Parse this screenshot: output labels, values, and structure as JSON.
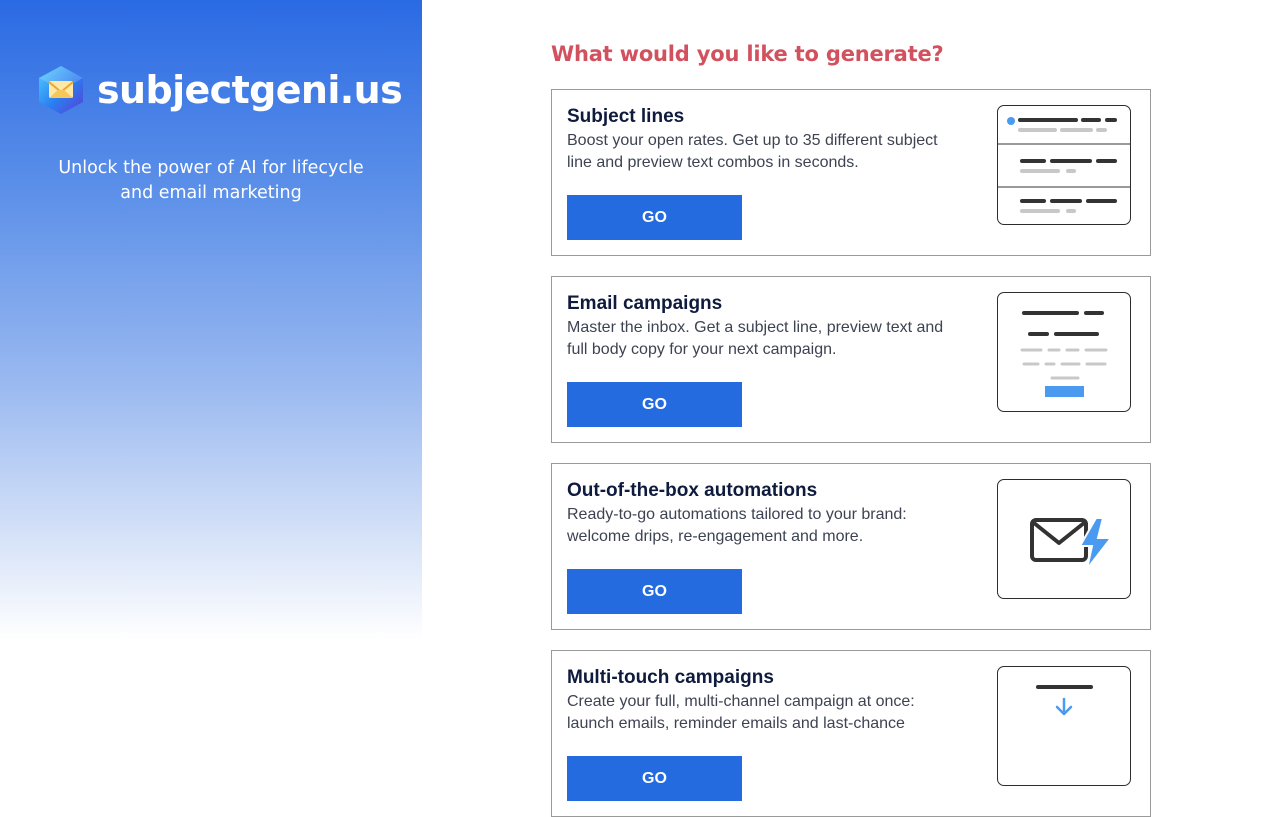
{
  "brand": {
    "name": "subjectgeni.us",
    "tagline": "Unlock the power of AI for lifecycle and email marketing",
    "logo_icon": "envelope-cube-icon"
  },
  "main": {
    "heading": "What would you like to generate?",
    "cards": [
      {
        "title": "Subject lines",
        "description": "Boost your open rates. Get up to 35 different subject line and preview text combos in seconds.",
        "button_label": "GO",
        "illustration": "subject-lines-list-icon"
      },
      {
        "title": "Email campaigns",
        "description": "Master the inbox. Get a subject line, preview text and full body copy for your next campaign.",
        "button_label": "GO",
        "illustration": "email-document-icon"
      },
      {
        "title": "Out-of-the-box automations",
        "description": "Ready-to-go automations tailored to your brand: welcome drips, re-engagement and more.",
        "button_label": "GO",
        "illustration": "envelope-lightning-icon"
      },
      {
        "title": "Multi-touch campaigns",
        "description": "Create your full, multi-channel campaign at once: launch emails, reminder emails and last-chance",
        "button_label": "GO",
        "illustration": "sequence-arrow-icon"
      }
    ]
  },
  "colors": {
    "accent_blue": "#256be0",
    "heading_red": "#d2515f",
    "title_navy": "#0f1b3d",
    "illustration_blue": "#4a9af0"
  }
}
